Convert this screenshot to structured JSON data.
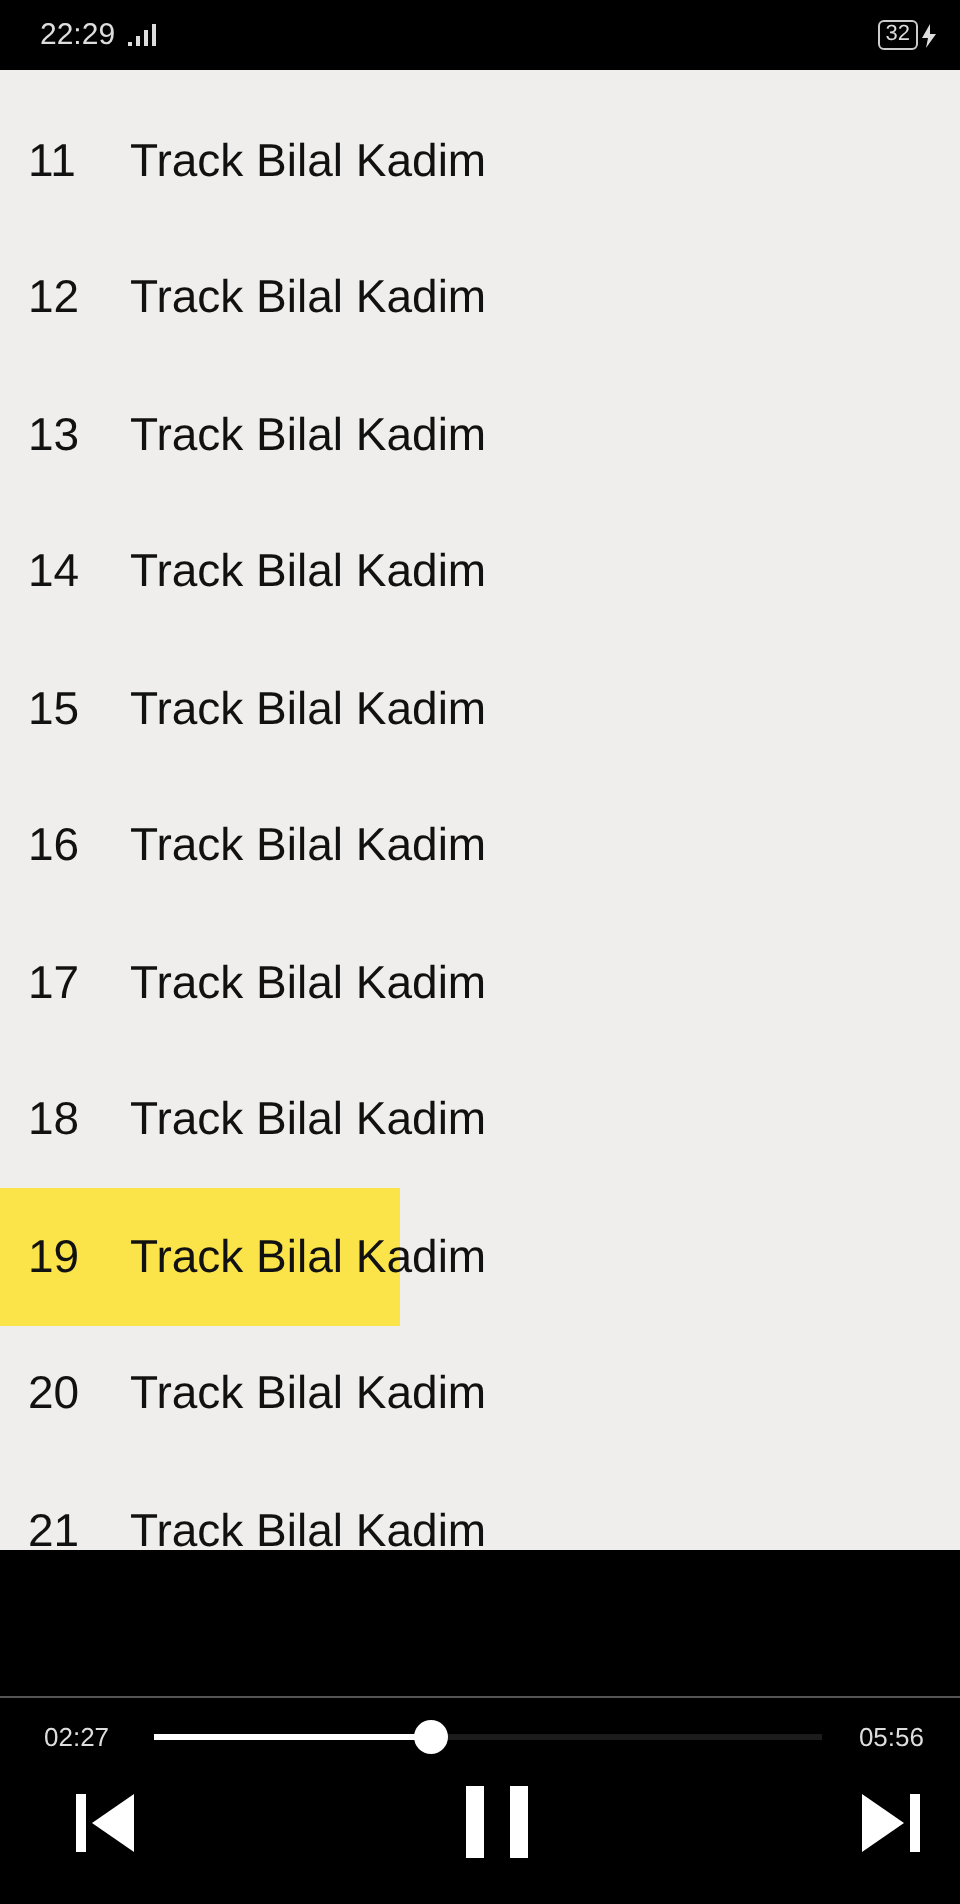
{
  "status_bar": {
    "time": "22:29",
    "battery": "32"
  },
  "tracks": [
    {
      "number": "11",
      "title": "Track Bilal Kadim",
      "selected": false
    },
    {
      "number": "12",
      "title": "Track Bilal Kadim",
      "selected": false
    },
    {
      "number": "13",
      "title": "Track Bilal Kadim",
      "selected": false
    },
    {
      "number": "14",
      "title": "Track Bilal Kadim",
      "selected": false
    },
    {
      "number": "15",
      "title": "Track Bilal Kadim",
      "selected": false
    },
    {
      "number": "16",
      "title": "Track Bilal Kadim",
      "selected": false
    },
    {
      "number": "17",
      "title": "Track Bilal Kadim",
      "selected": false
    },
    {
      "number": "18",
      "title": "Track Bilal Kadim",
      "selected": false
    },
    {
      "number": "19",
      "title": "Track Bilal Kadim",
      "selected": true
    },
    {
      "number": "20",
      "title": "Track Bilal Kadim",
      "selected": false
    },
    {
      "number": "21",
      "title": "Track Bilal Kadim",
      "selected": false
    }
  ],
  "player": {
    "elapsed": "02:27",
    "duration": "05:56",
    "level": 0.41,
    "playing": true
  }
}
